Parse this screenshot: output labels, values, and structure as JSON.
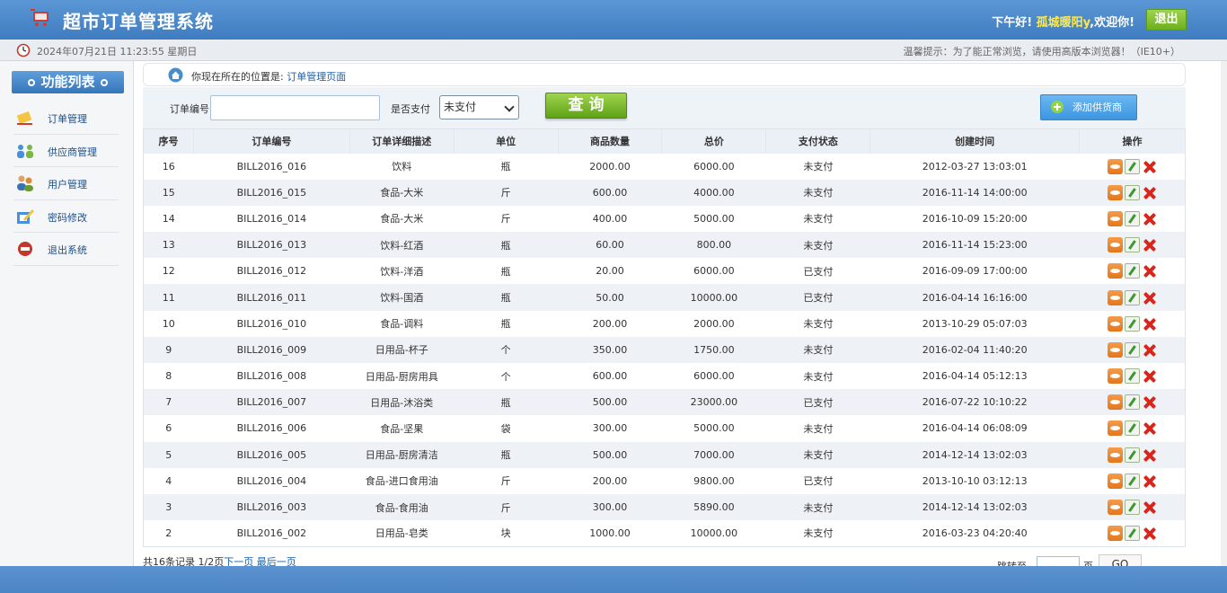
{
  "header": {
    "title": "超市订单管理系统",
    "greeting_prefix": "下午好!",
    "user": "孤城暖阳y",
    "greeting_suffix": ",欢迎你!",
    "logout": "退出"
  },
  "infobar": {
    "time": "2024年07月21日 11:23:55 星期日",
    "tip": "温馨提示：为了能正常浏览，请使用高版本浏览器！（IE10+）"
  },
  "sidebar": {
    "title": "功能列表",
    "items": [
      {
        "label": "订单管理",
        "icon": "order-icon"
      },
      {
        "label": "供应商管理",
        "icon": "provider-icon"
      },
      {
        "label": "用户管理",
        "icon": "users-icon"
      },
      {
        "label": "密码修改",
        "icon": "password-icon"
      },
      {
        "label": "退出系统",
        "icon": "exit-icon"
      }
    ]
  },
  "breadcrumb": {
    "prefix": "你现在所在的位置是:",
    "current": "订单管理页面"
  },
  "search": {
    "order_no_label": "订单编号",
    "order_no_value": "",
    "paid_label": "是否支付",
    "paid_value": "未支付",
    "query_button": "查 询",
    "add_button": "添加供货商"
  },
  "table": {
    "headers": [
      "序号",
      "订单编号",
      "订单详细描述",
      "单位",
      "商品数量",
      "总价",
      "支付状态",
      "创建时间",
      "操作"
    ],
    "rows": [
      [
        "16",
        "BILL2016_016",
        "饮料",
        "瓶",
        "2000.00",
        "6000.00",
        "未支付",
        "2012-03-27 13:03:01"
      ],
      [
        "15",
        "BILL2016_015",
        "食品-大米",
        "斤",
        "600.00",
        "4000.00",
        "未支付",
        "2016-11-14 14:00:00"
      ],
      [
        "14",
        "BILL2016_014",
        "食品-大米",
        "斤",
        "400.00",
        "5000.00",
        "未支付",
        "2016-10-09 15:20:00"
      ],
      [
        "13",
        "BILL2016_013",
        "饮料-红酒",
        "瓶",
        "60.00",
        "800.00",
        "未支付",
        "2016-11-14 15:23:00"
      ],
      [
        "12",
        "BILL2016_012",
        "饮料-洋酒",
        "瓶",
        "20.00",
        "6000.00",
        "已支付",
        "2016-09-09 17:00:00"
      ],
      [
        "11",
        "BILL2016_011",
        "饮料-国酒",
        "瓶",
        "50.00",
        "10000.00",
        "已支付",
        "2016-04-14 16:16:00"
      ],
      [
        "10",
        "BILL2016_010",
        "食品-调料",
        "瓶",
        "200.00",
        "2000.00",
        "未支付",
        "2013-10-29 05:07:03"
      ],
      [
        "9",
        "BILL2016_009",
        "日用品-杯子",
        "个",
        "350.00",
        "1750.00",
        "未支付",
        "2016-02-04 11:40:20"
      ],
      [
        "8",
        "BILL2016_008",
        "日用品-厨房用具",
        "个",
        "600.00",
        "6000.00",
        "未支付",
        "2016-04-14 05:12:13"
      ],
      [
        "7",
        "BILL2016_007",
        "日用品-沐浴类",
        "瓶",
        "500.00",
        "23000.00",
        "已支付",
        "2016-07-22 10:10:22"
      ],
      [
        "6",
        "BILL2016_006",
        "食品-坚果",
        "袋",
        "300.00",
        "5000.00",
        "未支付",
        "2016-04-14 06:08:09"
      ],
      [
        "5",
        "BILL2016_005",
        "日用品-厨房清洁",
        "瓶",
        "500.00",
        "7000.00",
        "未支付",
        "2014-12-14 13:02:03"
      ],
      [
        "4",
        "BILL2016_004",
        "食品-进口食用油",
        "斤",
        "200.00",
        "9800.00",
        "已支付",
        "2013-10-10 03:12:13"
      ],
      [
        "3",
        "BILL2016_003",
        "食品-食用油",
        "斤",
        "300.00",
        "5890.00",
        "未支付",
        "2014-12-14 13:02:03"
      ],
      [
        "2",
        "BILL2016_002",
        "日用品-皂类",
        "块",
        "1000.00",
        "10000.00",
        "未支付",
        "2016-03-23 04:20:40"
      ]
    ]
  },
  "pager": {
    "summary": "共16条记录 1/2页",
    "next": "下一页",
    "last": "最后一页",
    "jump_label": "跳转至",
    "jump_value": "",
    "page_unit": "页",
    "go": "GO"
  }
}
